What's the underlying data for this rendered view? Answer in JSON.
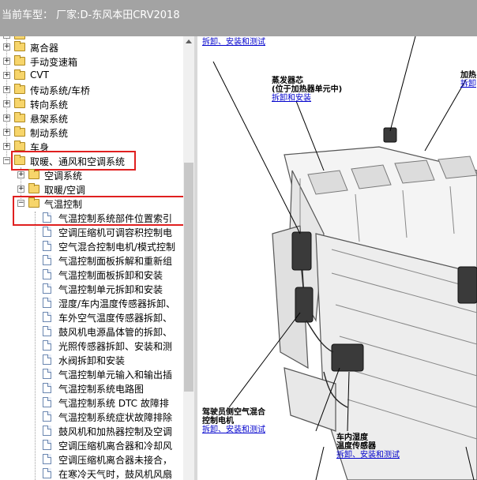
{
  "header": {
    "title": "当前车型：  厂家:D-东风本田CRV2018"
  },
  "tree": {
    "top_folders": [
      {
        "label": "离合器"
      },
      {
        "label": "手动变速箱"
      },
      {
        "label": "CVT"
      },
      {
        "label": "传动系统/车桥"
      },
      {
        "label": "转向系统"
      },
      {
        "label": "悬架系统"
      },
      {
        "label": "制动系统"
      },
      {
        "label": "车身"
      }
    ],
    "selected_category": "取暖、通风和空调系统",
    "sub_folders": [
      {
        "label": "空调系统"
      },
      {
        "label": "取暖/空调"
      },
      {
        "label": "气温控制"
      }
    ],
    "documents": [
      {
        "label": "气温控制系统部件位置索引"
      },
      {
        "label": "空调压缩机可调容积控制电"
      },
      {
        "label": "空气混合控制电机/模式控制"
      },
      {
        "label": "气温控制面板拆解和重新组"
      },
      {
        "label": "气温控制面板拆卸和安装"
      },
      {
        "label": "气温控制单元拆卸和安装"
      },
      {
        "label": "湿度/车内温度传感器拆卸、"
      },
      {
        "label": "车外空气温度传感器拆卸、"
      },
      {
        "label": "鼓风机电源晶体管的拆卸、"
      },
      {
        "label": "光照传感器拆卸、安装和测"
      },
      {
        "label": "水阀拆卸和安装"
      },
      {
        "label": "气温控制单元输入和输出插"
      },
      {
        "label": "气温控制系统电路图"
      },
      {
        "label": "气温控制系统 DTC 故障排"
      },
      {
        "label": "气温控制系统症状故障排除"
      },
      {
        "label": "鼓风机和加热器控制及空调"
      },
      {
        "label": "空调压缩机离合器和冷却风"
      },
      {
        "label": "空调压缩机离合器未接合，"
      },
      {
        "label": "在寒冷天气时，鼓风机风扇"
      }
    ]
  },
  "diagram": {
    "link_text": "拆卸、安装和测试",
    "evap_title_line1": "蒸发器芯",
    "evap_title_line2": "(位于加热器单元中)",
    "evap_link": "拆卸和安装",
    "right_top_title": "加热",
    "right_top_link": "拆卸",
    "motor_title_line1": "驾驶员侧空气混合",
    "motor_title_line2": "控制电机",
    "motor_link": "拆卸、安装和测试",
    "sensor_title_line1": "车内湿度",
    "sensor_title_line2": "温度传感器",
    "sensor_link": "拆卸、安装和测试"
  }
}
